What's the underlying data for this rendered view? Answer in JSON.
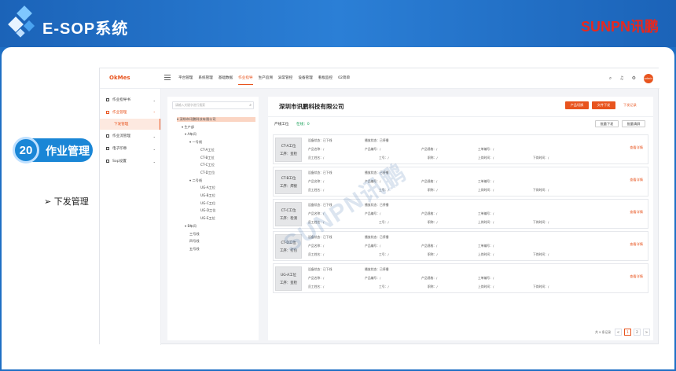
{
  "slide": {
    "title": "E-SOP系统",
    "brand_part1": "SUNPN",
    "brand_part2": "讯鹏",
    "section_number": "20",
    "section_title": "作业管理",
    "bullet": "下发管理",
    "watermark": "SUNPN讯鹏"
  },
  "app": {
    "logo": "OkMes",
    "nav": [
      "平台管理",
      "系统管理",
      "基础数据",
      "作业指导",
      "生产追溯",
      "异常管控",
      "设备管理",
      "看板监控",
      "02简单"
    ],
    "nav_active_index": 3,
    "top_icons": [
      "search-icon",
      "bell-icon",
      "settings-icon"
    ],
    "avatar_text": "admin",
    "sidebar": [
      {
        "label": "作业指导书",
        "open": false
      },
      {
        "label": "作业管理",
        "open": true,
        "children": [
          "下发管理"
        ]
      },
      {
        "label": "作业流管理",
        "open": false
      },
      {
        "label": "电子印章",
        "open": false
      },
      {
        "label": "Sop设置",
        "open": false
      }
    ],
    "tree": {
      "search_placeholder": "请输入关键字进行搜索",
      "nodes": [
        {
          "label": "深圳市讯鹏科技有限公司",
          "selected": true
        },
        {
          "label": "生产部"
        },
        {
          "label": "A车间"
        },
        {
          "label": "一号线"
        },
        {
          "label": "CT-A工位"
        },
        {
          "label": "CT-B工位"
        },
        {
          "label": "CT-C工位"
        },
        {
          "label": "CT-D工位"
        },
        {
          "label": "二号线"
        },
        {
          "label": "UG-A工位"
        },
        {
          "label": "UG-B工位"
        },
        {
          "label": "UG-C工位"
        },
        {
          "label": "UG-D工位"
        },
        {
          "label": "UG-E工位"
        },
        {
          "label": "B车间"
        },
        {
          "label": "三号线"
        },
        {
          "label": "四号线"
        },
        {
          "label": "五号线"
        }
      ]
    },
    "main": {
      "company": "深圳市讯鹏科技有限公司",
      "btn_product_switch": "产品切换",
      "btn_file_issue": "文件下发",
      "link_issue_record": "下发记录",
      "line_label": "产线工位",
      "online": "在线：0",
      "btn_batch_issue": "批量下发",
      "btn_batch_clear": "批量清屏",
      "labels": {
        "device_status": "设备状态：",
        "play_status": "播放状态：",
        "product_name": "产品名称：",
        "product_code": "产品编号：",
        "product_model": "产品规格：",
        "work_order": "工单编号：",
        "employee_name": "员工姓名：",
        "employee_no": "工号：",
        "position": "职称：",
        "on_time": "上岗时间：",
        "off_time": "下岗时间："
      },
      "empty_value": "/",
      "detail_link": "查看详情",
      "stations": [
        {
          "name": "CT-A工位",
          "process": "工序：变检",
          "device_status": "已下线",
          "play_status": "已停播"
        },
        {
          "name": "CT-B工位",
          "process": "工序：焊接",
          "device_status": "已下线",
          "play_status": "已停播"
        },
        {
          "name": "CT-C工位",
          "process": "工序：检测",
          "device_status": "已下线",
          "play_status": "已停播"
        },
        {
          "name": "CT-D工位",
          "process": "工序：打包",
          "device_status": "已下线",
          "play_status": "已停播"
        },
        {
          "name": "UG-A工位",
          "process": "工序：变检",
          "device_status": "已下线",
          "play_status": "已停播"
        }
      ],
      "pagination": {
        "total": "共 9 条记录",
        "prev": "<",
        "pages": [
          "1",
          "2"
        ],
        "active": "1",
        "next": ">"
      }
    }
  }
}
